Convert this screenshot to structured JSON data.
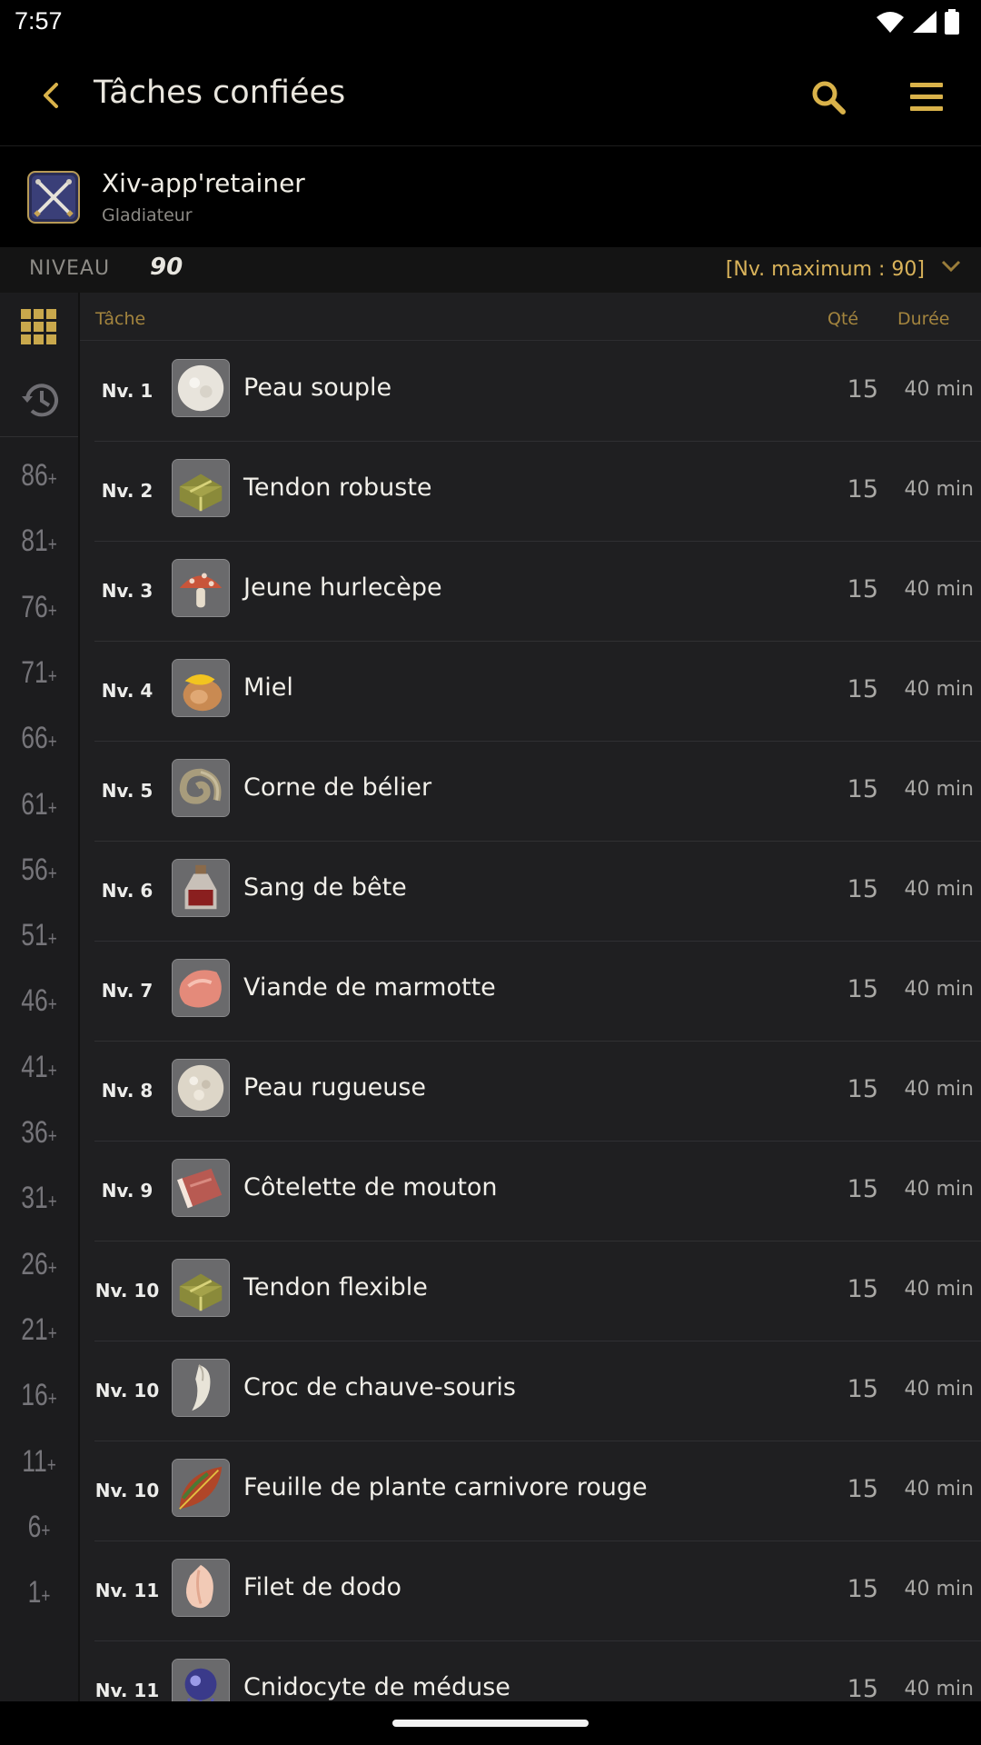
{
  "status": {
    "time": "7:57"
  },
  "header": {
    "title": "Tâches confiées"
  },
  "retainer": {
    "name": "Xiv-app'retainer",
    "job": "Gladiateur"
  },
  "level": {
    "label": "NIVEAU",
    "value": "90",
    "max": "[Nv. maximum : 90]"
  },
  "columns": {
    "task": "Tâche",
    "qty": "Qté",
    "duration": "Durée"
  },
  "sidebar": {
    "levels": [
      "86",
      "81",
      "76",
      "71",
      "66",
      "61",
      "56",
      "51",
      "46",
      "41",
      "36",
      "31",
      "26",
      "21",
      "16",
      "11",
      "6",
      "1"
    ],
    "plus": "+"
  },
  "tasks": [
    {
      "level": "Nv. 1",
      "name": "Peau souple",
      "qty": "15",
      "duration": "40 min",
      "icon": "hide-icon"
    },
    {
      "level": "Nv. 2",
      "name": "Tendon robuste",
      "qty": "15",
      "duration": "40 min",
      "icon": "sinew-icon"
    },
    {
      "level": "Nv. 3",
      "name": "Jeune hurlecèpe",
      "qty": "15",
      "duration": "40 min",
      "icon": "mushroom-icon"
    },
    {
      "level": "Nv. 4",
      "name": "Miel",
      "qty": "15",
      "duration": "40 min",
      "icon": "honey-icon"
    },
    {
      "level": "Nv. 5",
      "name": "Corne de bélier",
      "qty": "15",
      "duration": "40 min",
      "icon": "horn-icon"
    },
    {
      "level": "Nv. 6",
      "name": "Sang de bête",
      "qty": "15",
      "duration": "40 min",
      "icon": "blood-vial-icon"
    },
    {
      "level": "Nv. 7",
      "name": "Viande de marmotte",
      "qty": "15",
      "duration": "40 min",
      "icon": "meat-icon"
    },
    {
      "level": "Nv. 8",
      "name": "Peau rugueuse",
      "qty": "15",
      "duration": "40 min",
      "icon": "rough-hide-icon"
    },
    {
      "level": "Nv. 9",
      "name": "Côtelette de mouton",
      "qty": "15",
      "duration": "40 min",
      "icon": "chop-icon"
    },
    {
      "level": "Nv. 10",
      "name": "Tendon flexible",
      "qty": "15",
      "duration": "40 min",
      "icon": "sinew-icon"
    },
    {
      "level": "Nv. 10",
      "name": "Croc de chauve-souris",
      "qty": "15",
      "duration": "40 min",
      "icon": "fang-icon"
    },
    {
      "level": "Nv. 10",
      "name": "Feuille de plante carnivore rouge",
      "qty": "15",
      "duration": "40 min",
      "icon": "leaf-icon"
    },
    {
      "level": "Nv. 11",
      "name": "Filet de dodo",
      "qty": "15",
      "duration": "40 min",
      "icon": "fillet-icon"
    },
    {
      "level": "Nv. 11",
      "name": "Cnidocyte de méduse",
      "qty": "15",
      "duration": "40 min",
      "icon": "jellyfish-icon"
    }
  ]
}
